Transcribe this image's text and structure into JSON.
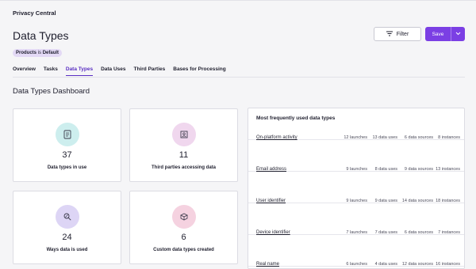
{
  "breadcrumb": "Privacy Central",
  "page_title": "Data Types",
  "filter_label": "Filter",
  "save_label": "Save",
  "badge": {
    "key": "Products",
    "text": " is ",
    "value": "Default"
  },
  "tabs": [
    {
      "label": "Overview"
    },
    {
      "label": "Tasks"
    },
    {
      "label": "Data Types",
      "active": true
    },
    {
      "label": "Data Uses"
    },
    {
      "label": "Third Parties"
    },
    {
      "label": "Bases for Processing"
    }
  ],
  "section_title": "Data Types Dashboard",
  "stats": [
    {
      "value": "37",
      "label": "Data types in use",
      "icon": "data-types-icon",
      "color": "#cdeeee"
    },
    {
      "value": "11",
      "label": "Third parties accessing data",
      "icon": "third-party-icon",
      "color": "#f0d7ee"
    },
    {
      "value": "24",
      "label": "Ways data is used",
      "icon": "data-use-icon",
      "color": "#ddd5f5"
    },
    {
      "value": "6",
      "label": "Custom data types created",
      "icon": "custom-type-icon",
      "color": "#f5d2e0"
    }
  ],
  "table": {
    "title": "Most frequently used data types",
    "rows": [
      {
        "name": "On-platform activity",
        "launches": "12 launches",
        "uses": "13 data uses",
        "sources": "6 data sources",
        "instances": "8 instances"
      },
      {
        "name": "Email address",
        "launches": "9 launches",
        "uses": "8 data uses",
        "sources": "9 data sources",
        "instances": "13 instances"
      },
      {
        "name": "User identifier",
        "launches": "9 launches",
        "uses": "9 data uses",
        "sources": "14 data sources",
        "instances": "18 instances"
      },
      {
        "name": "Device identifier",
        "launches": "7 launches",
        "uses": "7 data uses",
        "sources": "6 data sources",
        "instances": "7 instances"
      },
      {
        "name": "Real name",
        "launches": "6 launches",
        "uses": "4 data uses",
        "sources": "12 data sources",
        "instances": "16 instances"
      }
    ]
  }
}
